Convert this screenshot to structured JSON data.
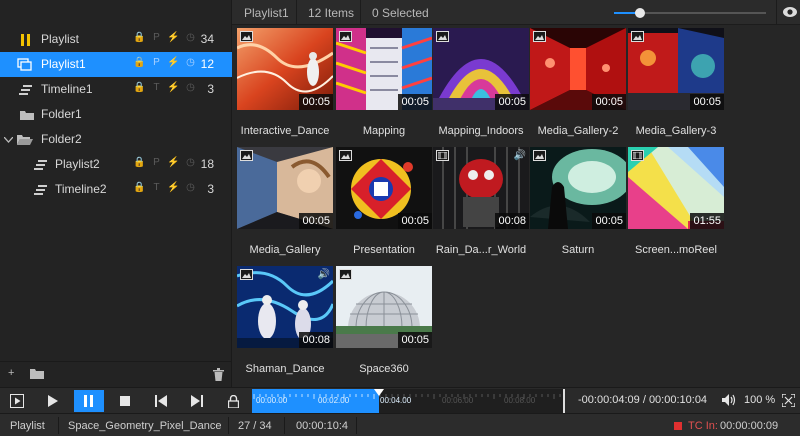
{
  "sidebar": {
    "items": [
      {
        "label": "Playlist",
        "count": "34",
        "flags": [
          "🔒",
          "P",
          "⚡",
          "⏱"
        ]
      },
      {
        "label": "Playlist1",
        "count": "12",
        "flags": [
          "🔒",
          "P",
          "⚡",
          "⏱"
        ]
      },
      {
        "label": "Timeline1",
        "count": "3",
        "flags": [
          "🔒",
          "T",
          "⚡",
          "⏱"
        ]
      },
      {
        "label": "Folder1"
      },
      {
        "label": "Folder2"
      },
      {
        "label": "Playlist2",
        "count": "18",
        "flags": [
          "🔒",
          "P",
          "⚡",
          "⏱"
        ]
      },
      {
        "label": "Timeline2",
        "count": "3",
        "flags": [
          "🔒",
          "T",
          "⚡",
          "⏱"
        ]
      }
    ],
    "add_label": "+"
  },
  "header": {
    "playlist_name": "Playlist1",
    "item_count": "12 Items",
    "selected_count": "0 Selected",
    "zoom_slider_value": 0.45
  },
  "media": [
    {
      "label": "Interactive_Dance",
      "duration": "00:05",
      "type": "image"
    },
    {
      "label": "Mapping",
      "duration": "00:05",
      "type": "image"
    },
    {
      "label": "Mapping_Indoors",
      "duration": "00:05",
      "type": "image"
    },
    {
      "label": "Media_Gallery-2",
      "duration": "00:05",
      "type": "image"
    },
    {
      "label": "Media_Gallery-3",
      "duration": "00:05",
      "type": "image"
    },
    {
      "label": "Media_Gallery",
      "duration": "00:05",
      "type": "image"
    },
    {
      "label": "Presentation",
      "duration": "00:05",
      "type": "image"
    },
    {
      "label": "Rain_Da...r_World",
      "duration": "00:08",
      "type": "video"
    },
    {
      "label": "Saturn",
      "duration": "00:05",
      "type": "image"
    },
    {
      "label": "Screen...moReel",
      "duration": "01:55",
      "type": "video"
    },
    {
      "label": "Shaman_Dance",
      "duration": "00:08",
      "type": "image"
    },
    {
      "label": "Space360",
      "duration": "00:05",
      "type": "image"
    }
  ],
  "transport": {
    "ticks": [
      "00:00.00",
      "00:02.00",
      "00:04.00",
      "00:06.00",
      "00:08.00"
    ],
    "progress": 0.408,
    "timecode": "-00:00:04:09 / 00:00:10:04",
    "volume": "100 %"
  },
  "status": {
    "mode": "Playlist",
    "current_item": "Space_Geometry_Pixel_Dance",
    "position": "27 / 34",
    "elapsed": "00:00:10:4",
    "tc_in_label": "TC In:",
    "tc_in_value": "00:00:00:09"
  },
  "colors": {
    "accent": "#1e90ff",
    "pause_icon": "#f2c200",
    "tc_indicator": "#e03030"
  }
}
